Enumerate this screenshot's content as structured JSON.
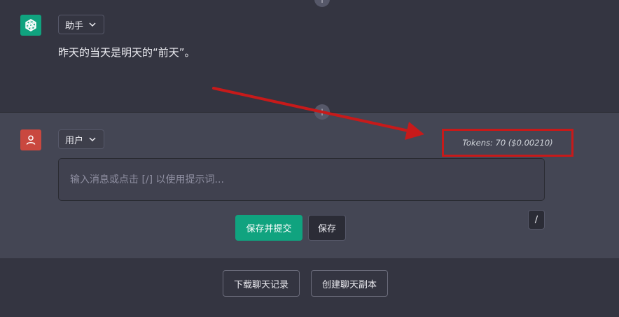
{
  "assistant": {
    "role_label": "助手",
    "message": "昨天的当天是明天的“前天”。"
  },
  "user": {
    "role_label": "用户",
    "input_value": "",
    "input_placeholder": "输入消息或点击 [/] 以使用提示词...",
    "token_info": "Tokens: 70 ($0.00210)"
  },
  "buttons": {
    "save_submit": "保存并提交",
    "save": "保存",
    "slash": "/"
  },
  "footer": {
    "download": "下载聊天记录",
    "copy": "创建聊天副本"
  },
  "colors": {
    "assistant_avatar": "#10a37f",
    "user_avatar": "#c9483f",
    "accent": "#10a37f",
    "annotation": "#c71a1a"
  }
}
